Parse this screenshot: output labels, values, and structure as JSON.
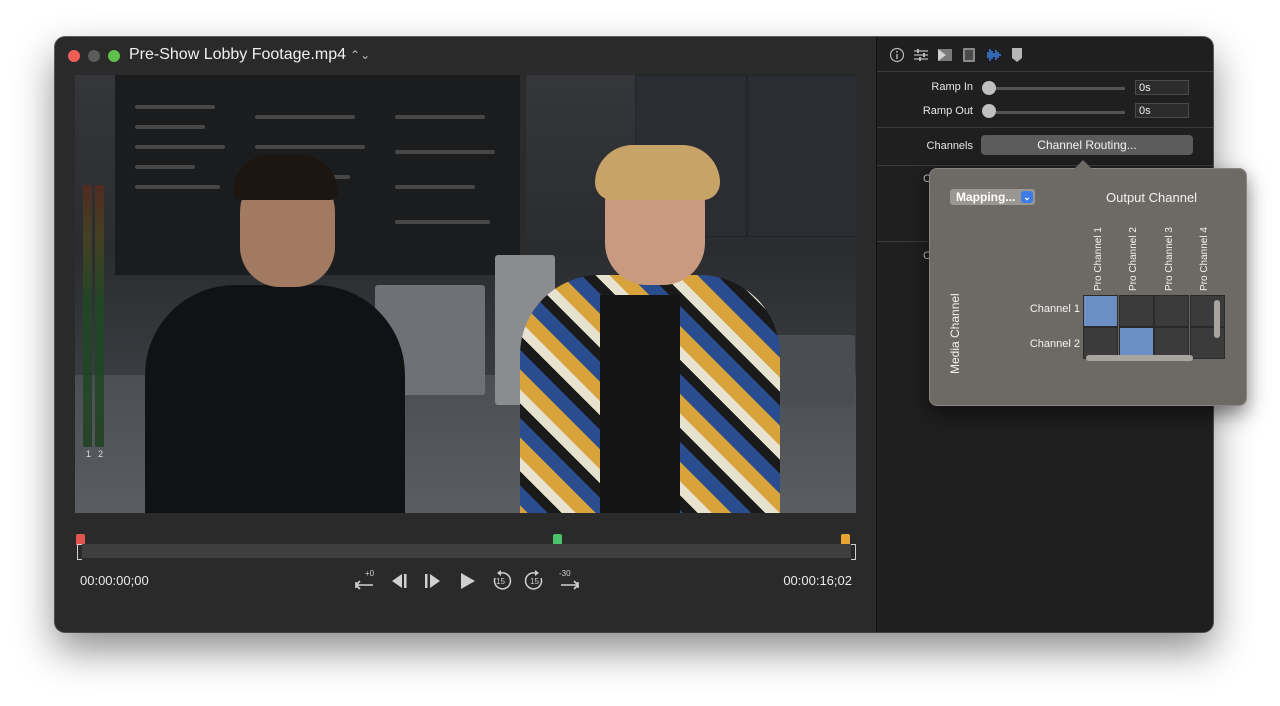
{
  "window": {
    "title": "Pre-Show Lobby Footage.mp4",
    "title_chevron": "⌃⌄"
  },
  "player": {
    "start_timecode": "00:00:00;00",
    "end_timecode": "00:00:16;02",
    "meter_labels": [
      "1",
      "2"
    ],
    "transport": {
      "jump_back_label": "+0",
      "skip_back_label": "15",
      "skip_forward_label": "15",
      "jump_forward_label": "-30"
    },
    "markers": {
      "in_color": "#e0554f",
      "playhead_color": "#4cc36a",
      "out_color": "#e6a532"
    }
  },
  "inspector": {
    "tabs": [
      "info-icon",
      "sliders-icon",
      "transition-icon",
      "film-icon",
      "waveform-icon",
      "marker-icon"
    ],
    "active_tab": "waveform-icon",
    "ramp_in": {
      "label": "Ramp In",
      "value": "0s"
    },
    "ramp_out": {
      "label": "Ramp Out",
      "value": "0s"
    },
    "channels": {
      "label": "Channels",
      "button": "Channel Routing..."
    },
    "hidden_label_1": "C",
    "hidden_label_2": "C"
  },
  "routing_popover": {
    "mapping_button": "Mapping...",
    "output_title": "Output Channel",
    "media_title": "Media Channel",
    "output_channels": [
      "Pro Channel 1",
      "Pro Channel 2",
      "Pro Channel 3",
      "Pro Channel 4"
    ],
    "media_channels": [
      "Channel 1",
      "Channel 2"
    ],
    "matrix": [
      [
        1,
        0,
        0,
        0
      ],
      [
        0,
        1,
        0,
        0
      ]
    ],
    "accent": "#6b8fc5"
  }
}
